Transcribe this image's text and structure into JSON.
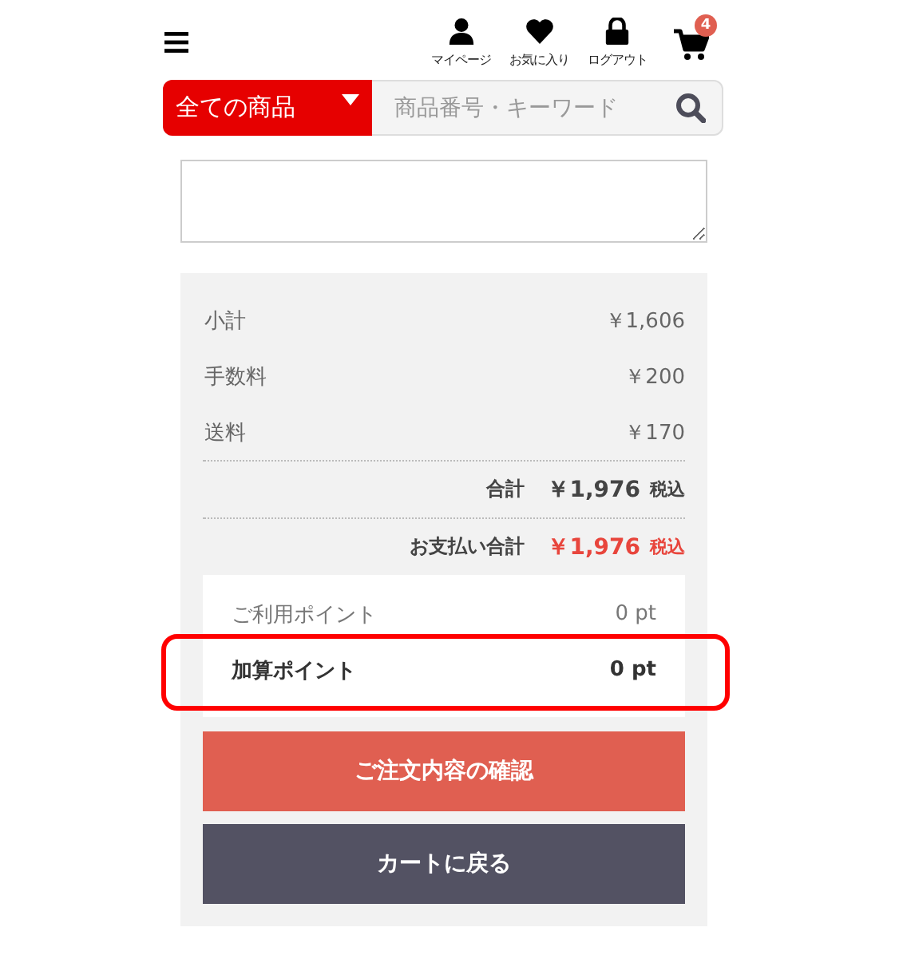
{
  "header": {
    "nav_items": [
      {
        "kind": "user",
        "label": "マイページ"
      },
      {
        "kind": "heart",
        "label": "お気に入り"
      },
      {
        "kind": "lock",
        "label": "ログアウト"
      }
    ],
    "cart_count": "4"
  },
  "search": {
    "category": "全ての商品",
    "placeholder": "商品番号・キーワード"
  },
  "summary": {
    "rows": [
      {
        "label": "小計",
        "amount": "￥1,606"
      },
      {
        "label": "手数料",
        "amount": "￥200"
      },
      {
        "label": "送料",
        "amount": "￥170"
      }
    ],
    "totals": [
      {
        "label": "合計",
        "amount": "￥1,976",
        "tax": "税込",
        "accent": false
      },
      {
        "label": "お支払い合計",
        "amount": "￥1,976",
        "tax": "税込",
        "accent": true
      }
    ],
    "points": [
      {
        "label": "ご利用ポイント",
        "value": "0 pt",
        "bold": false,
        "highlighted": false
      },
      {
        "label": "加算ポイント",
        "value": "0 pt",
        "bold": true,
        "highlighted": true
      }
    ]
  },
  "buttons": [
    {
      "kind": "primary",
      "label": "ご注文内容の確認"
    },
    {
      "kind": "secondary",
      "label": "カートに戻る"
    }
  ]
}
